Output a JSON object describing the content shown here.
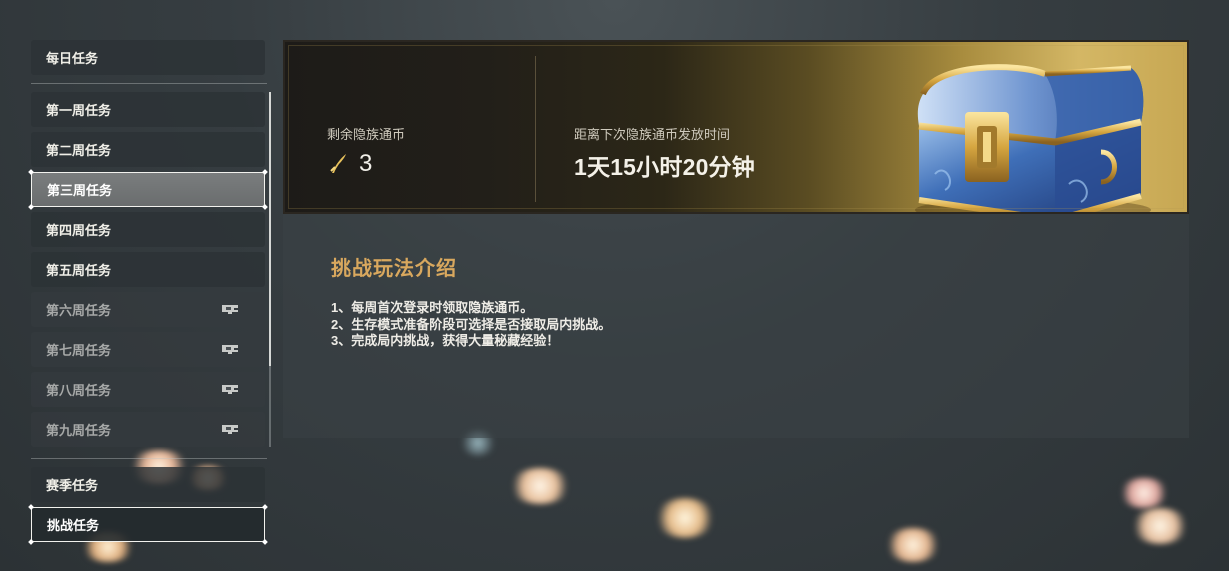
{
  "sidebar": {
    "daily": "每日任务",
    "weeks": [
      {
        "label": "第一周任务",
        "locked": false
      },
      {
        "label": "第二周任务",
        "locked": false
      },
      {
        "label": "第三周任务",
        "locked": false,
        "selected": true
      },
      {
        "label": "第四周任务",
        "locked": false
      },
      {
        "label": "第五周任务",
        "locked": false
      },
      {
        "label": "第六周任务",
        "locked": true
      },
      {
        "label": "第七周任务",
        "locked": true
      },
      {
        "label": "第八周任务",
        "locked": true
      },
      {
        "label": "第九周任务",
        "locked": true
      }
    ],
    "season": "赛季任务",
    "challenge": "挑战任务"
  },
  "banner": {
    "coin_label": "剩余隐族通币",
    "coin_value": "3",
    "next_label": "距离下次隐族通币发放时间",
    "next_value": "1天15小时20分钟"
  },
  "intro": {
    "title": "挑战玩法介绍",
    "rules": [
      "1、每周首次登录时领取隐族通币。",
      "2、生存模式准备阶段可选择是否接取局内挑战。",
      "3、完成局内挑战，获得大量秘藏经验！"
    ]
  },
  "icons": {
    "coin": "feather-icon",
    "lock": "lock-icon",
    "chest": "treasure-chest-icon"
  },
  "colors": {
    "accent_gold": "#d9a85e",
    "selected_tab": "#727576"
  }
}
